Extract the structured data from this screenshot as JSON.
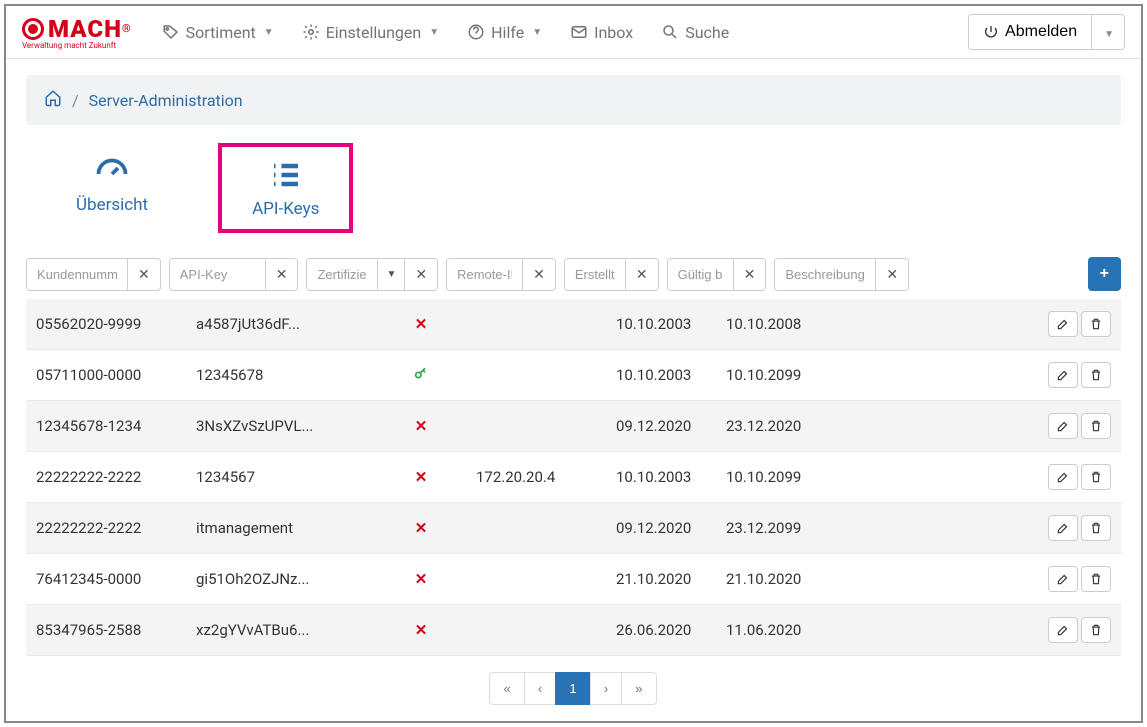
{
  "logo": {
    "main": "MACH",
    "reg": "®",
    "sub": "Verwaltung macht Zukunft"
  },
  "nav": {
    "sortiment": "Sortiment",
    "einstellungen": "Einstellungen",
    "hilfe": "Hilfe",
    "inbox": "Inbox",
    "suche": "Suche",
    "abmelden": "Abmelden"
  },
  "breadcrumb": {
    "current": "Server-Administration"
  },
  "tabs": {
    "overview": "Übersicht",
    "apikeys": "API-Keys"
  },
  "filters": {
    "kundennummer": "Kundennummer",
    "apikey": "API-Key",
    "zertifiziert": "Zertifiziert",
    "remoteip": "Remote-IP",
    "erstellt": "Erstellt",
    "gueltig": "Gültig bis",
    "beschreibung": "Beschreibung"
  },
  "rows": [
    {
      "kn": "05562020-9999",
      "key": "a4587jUt36dF...",
      "cert": false,
      "ip": "",
      "created": "10.10.2003",
      "valid": "10.10.2008"
    },
    {
      "kn": "05711000-0000",
      "key": "12345678",
      "cert": true,
      "ip": "",
      "created": "10.10.2003",
      "valid": "10.10.2099"
    },
    {
      "kn": "12345678-1234",
      "key": "3NsXZvSzUPVL...",
      "cert": false,
      "ip": "",
      "created": "09.12.2020",
      "valid": "23.12.2020"
    },
    {
      "kn": "22222222-2222",
      "key": "1234567",
      "cert": false,
      "ip": "172.20.20.4",
      "created": "10.10.2003",
      "valid": "10.10.2099"
    },
    {
      "kn": "22222222-2222",
      "key": "itmanagement",
      "cert": false,
      "ip": "",
      "created": "09.12.2020",
      "valid": "23.12.2099"
    },
    {
      "kn": "76412345-0000",
      "key": "gi51Oh2OZJNz...",
      "cert": false,
      "ip": "",
      "created": "21.10.2020",
      "valid": "21.10.2020"
    },
    {
      "kn": "85347965-2588",
      "key": "xz2gYVvATBu6...",
      "cert": false,
      "ip": "",
      "created": "26.06.2020",
      "valid": "11.06.2020"
    }
  ],
  "pagination": {
    "first": "«",
    "prev": "‹",
    "current": "1",
    "next": "›",
    "last": "»"
  },
  "add": "+"
}
